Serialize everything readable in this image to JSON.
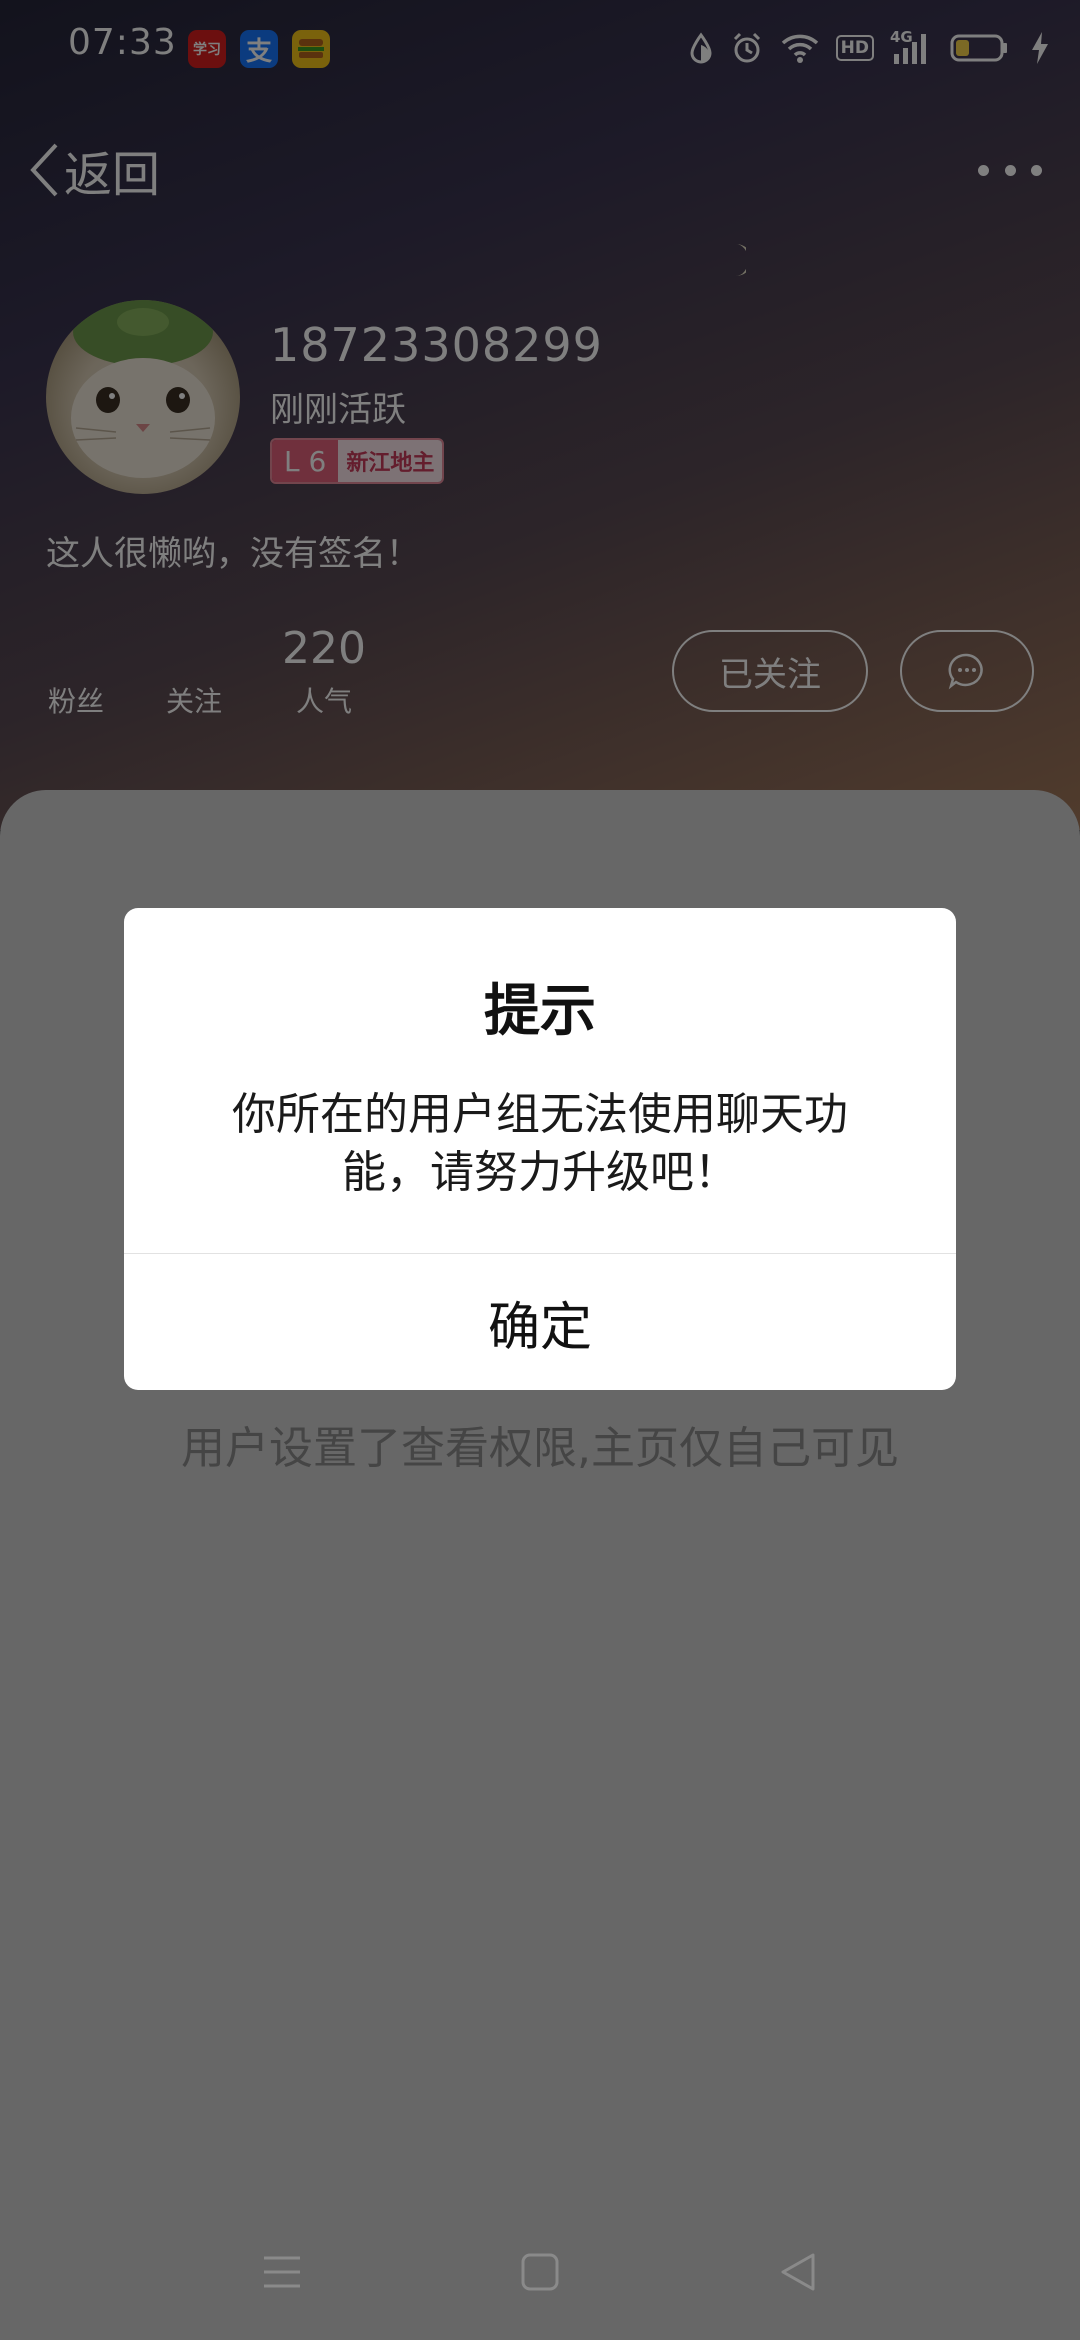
{
  "status_bar": {
    "time": "07:33",
    "apps": [
      {
        "icon": "xuexi-app-icon",
        "color": "#d81e1e",
        "label": "学习"
      },
      {
        "icon": "alipay-app-icon",
        "color": "#1677ff",
        "label": "支"
      },
      {
        "icon": "food-app-icon",
        "color": "#f5c518",
        "label": ""
      }
    ],
    "network": "4G",
    "hd": "HD",
    "battery_level": 0.3
  },
  "nav": {
    "back_label": "返回"
  },
  "profile": {
    "username": "18723308299",
    "active_status": "刚刚活跃",
    "level": "L 6",
    "level_title": "新江地主",
    "signature": "这人很懒哟，没有签名！",
    "stats": {
      "fans_value": "",
      "fans_label": "粉丝",
      "following_value": "",
      "following_label": "关注",
      "popularity_value": "220",
      "popularity_label": "人气"
    },
    "follow_button": "已关注"
  },
  "content": {
    "private_notice": "用户设置了查看权限,主页仅自己可见"
  },
  "dialog": {
    "title": "提示",
    "message": "你所在的用户组无法使用聊天功能，请努力升级吧！",
    "confirm": "确定"
  },
  "colors": {
    "level_badge": "#e0607a",
    "overlay": "rgba(0,0,0,0.5)"
  }
}
